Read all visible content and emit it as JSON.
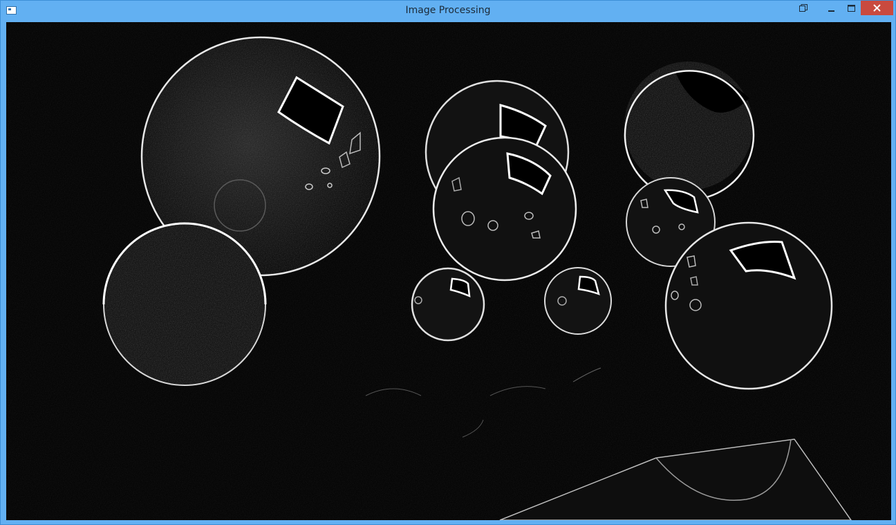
{
  "window": {
    "title": "Image Processing",
    "controls": {
      "restore": "restore-icon",
      "minimize": "minimize-icon",
      "maximize": "maximize-icon",
      "close": "close-icon"
    },
    "colors": {
      "frame": "#62b0f2",
      "close_button": "#c94a3f",
      "canvas_background": "#050505",
      "edge_lines": "#ffffff"
    }
  }
}
